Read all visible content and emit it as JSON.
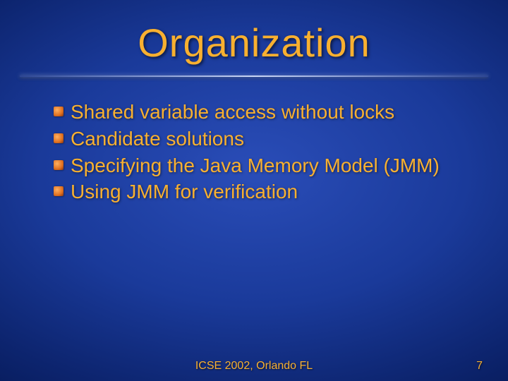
{
  "title": "Organization",
  "bullets": [
    "Shared variable access without locks",
    "Candidate solutions",
    "Specifying the Java Memory Model (JMM)",
    "Using JMM for verification"
  ],
  "footer": "ICSE 2002, Orlando FL",
  "page_number": "7"
}
